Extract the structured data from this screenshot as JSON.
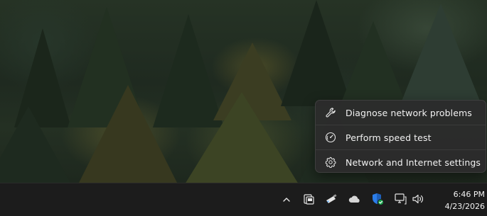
{
  "context_menu": {
    "items": [
      {
        "label": "Diagnose network problems",
        "icon": "wrench-icon"
      },
      {
        "label": "Perform speed test",
        "icon": "speedometer-icon"
      },
      {
        "label": "Network and Internet settings",
        "icon": "gear-icon"
      }
    ]
  },
  "taskbar": {
    "tray_icons": [
      "chevron-up-icon",
      "app-tray-icon",
      "usb-drive-icon",
      "onedrive-cloud-icon",
      "defender-shield-icon",
      "network-icon",
      "volume-icon"
    ],
    "clock": {
      "time": "6:46 PM",
      "date": "4/23/2026"
    }
  },
  "colors": {
    "menu_bg": "#2c2c2c",
    "taskbar_bg": "#1c1c1c",
    "text": "#f2f2f2",
    "defender_badge": "#16a34a",
    "onedrive_cloud": "#d6d6d6"
  }
}
